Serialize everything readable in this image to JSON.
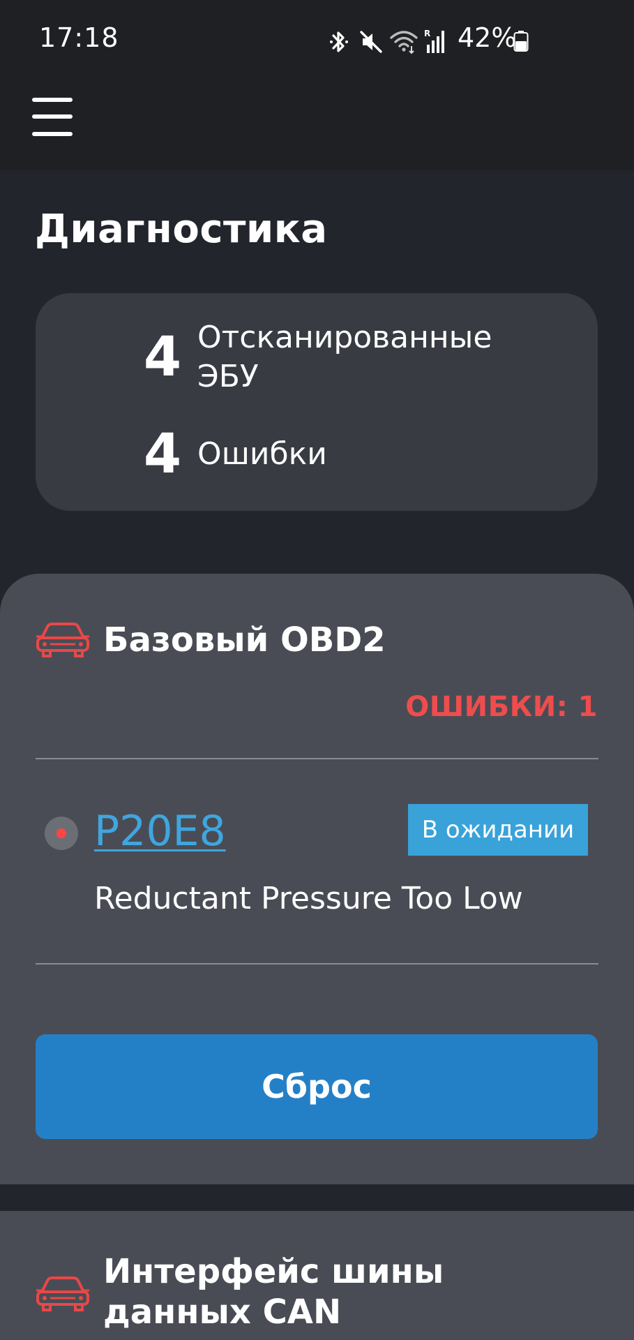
{
  "status_bar": {
    "time": "17:18",
    "battery_percent": "42%",
    "icons": [
      "bluetooth-icon",
      "mute-icon",
      "wifi-icon",
      "signal-roaming-icon",
      "battery-icon"
    ]
  },
  "app_bar": {
    "menu_icon": "hamburger-menu-icon"
  },
  "page": {
    "title": "Диагностика"
  },
  "summary": {
    "scanned_count": "4",
    "scanned_label": "Отсканированные ЭБУ",
    "errors_count": "4",
    "errors_label": "Ошибки"
  },
  "ecus": [
    {
      "icon": "car-icon",
      "name": "Базовый OBD2",
      "errors_label": "ОШИБКИ: 1",
      "dtcs": [
        {
          "code": "P20E8",
          "status": "В ожидании",
          "description": "Reductant Pressure Too Low"
        }
      ],
      "reset_label": "Сброс"
    },
    {
      "icon": "car-icon",
      "name": "Интерфейс шины данных CAN"
    }
  ],
  "colors": {
    "background": "#23252c",
    "card": "#383b42",
    "panel": "#4a4c55",
    "error_red": "#ef4d4d",
    "link_blue": "#3fa6df",
    "status_blue": "#39a2d9",
    "button_blue": "#2480c6"
  }
}
